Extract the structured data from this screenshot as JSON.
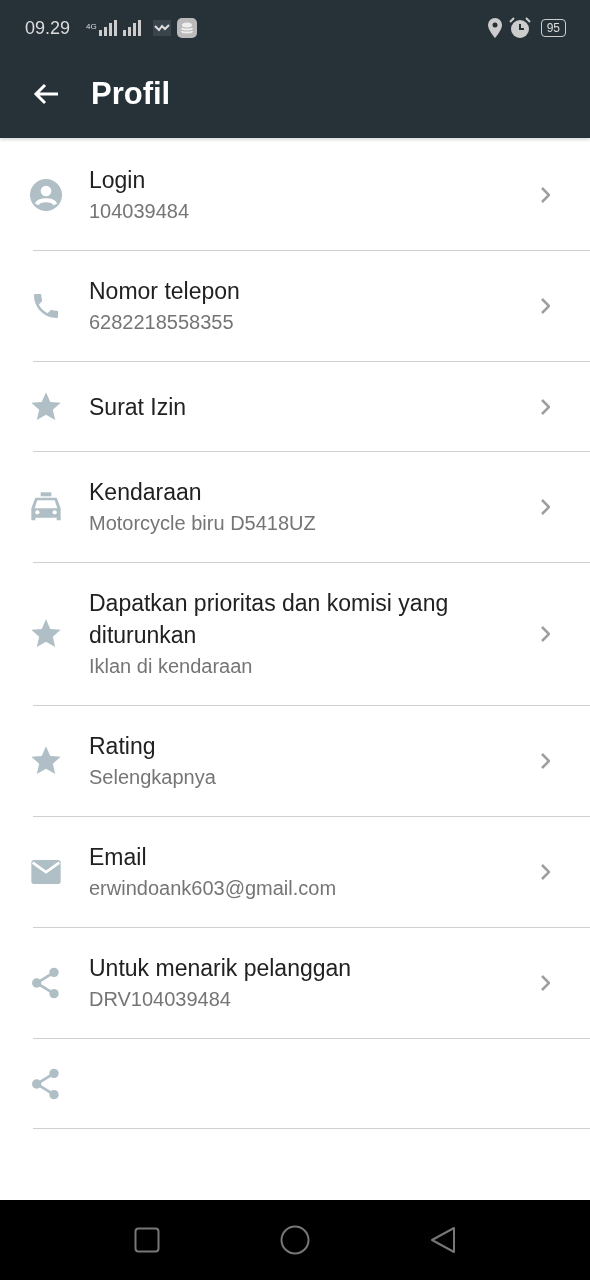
{
  "status_bar": {
    "time": "09.29",
    "network": "4G",
    "battery": "95"
  },
  "app_bar": {
    "title": "Profil"
  },
  "items": [
    {
      "kind": "account",
      "title": "Login",
      "subtitle": "104039484",
      "chevron": true
    },
    {
      "kind": "phone",
      "title": "Nomor telepon",
      "subtitle": "6282218558355",
      "chevron": true
    },
    {
      "kind": "star",
      "title": "Surat Izin",
      "chevron": true
    },
    {
      "kind": "car",
      "title": "Kendaraan",
      "subtitle": "Motorcycle biru D5418UZ",
      "chevron": true
    },
    {
      "kind": "star",
      "title": "Dapatkan prioritas dan komisi yang diturunkan",
      "subtitle": "Iklan di kendaraan",
      "chevron": true
    },
    {
      "kind": "star",
      "title": "Rating",
      "subtitle": "Selengkapnya",
      "chevron": true
    },
    {
      "kind": "mail",
      "title": "Email",
      "subtitle": "erwindoank603@gmail.com",
      "chevron": true
    },
    {
      "kind": "share",
      "title": "Untuk menarik pelanggan",
      "subtitle": "DRV104039484",
      "chevron": true
    },
    {
      "kind": "share",
      "chevron": false
    }
  ]
}
